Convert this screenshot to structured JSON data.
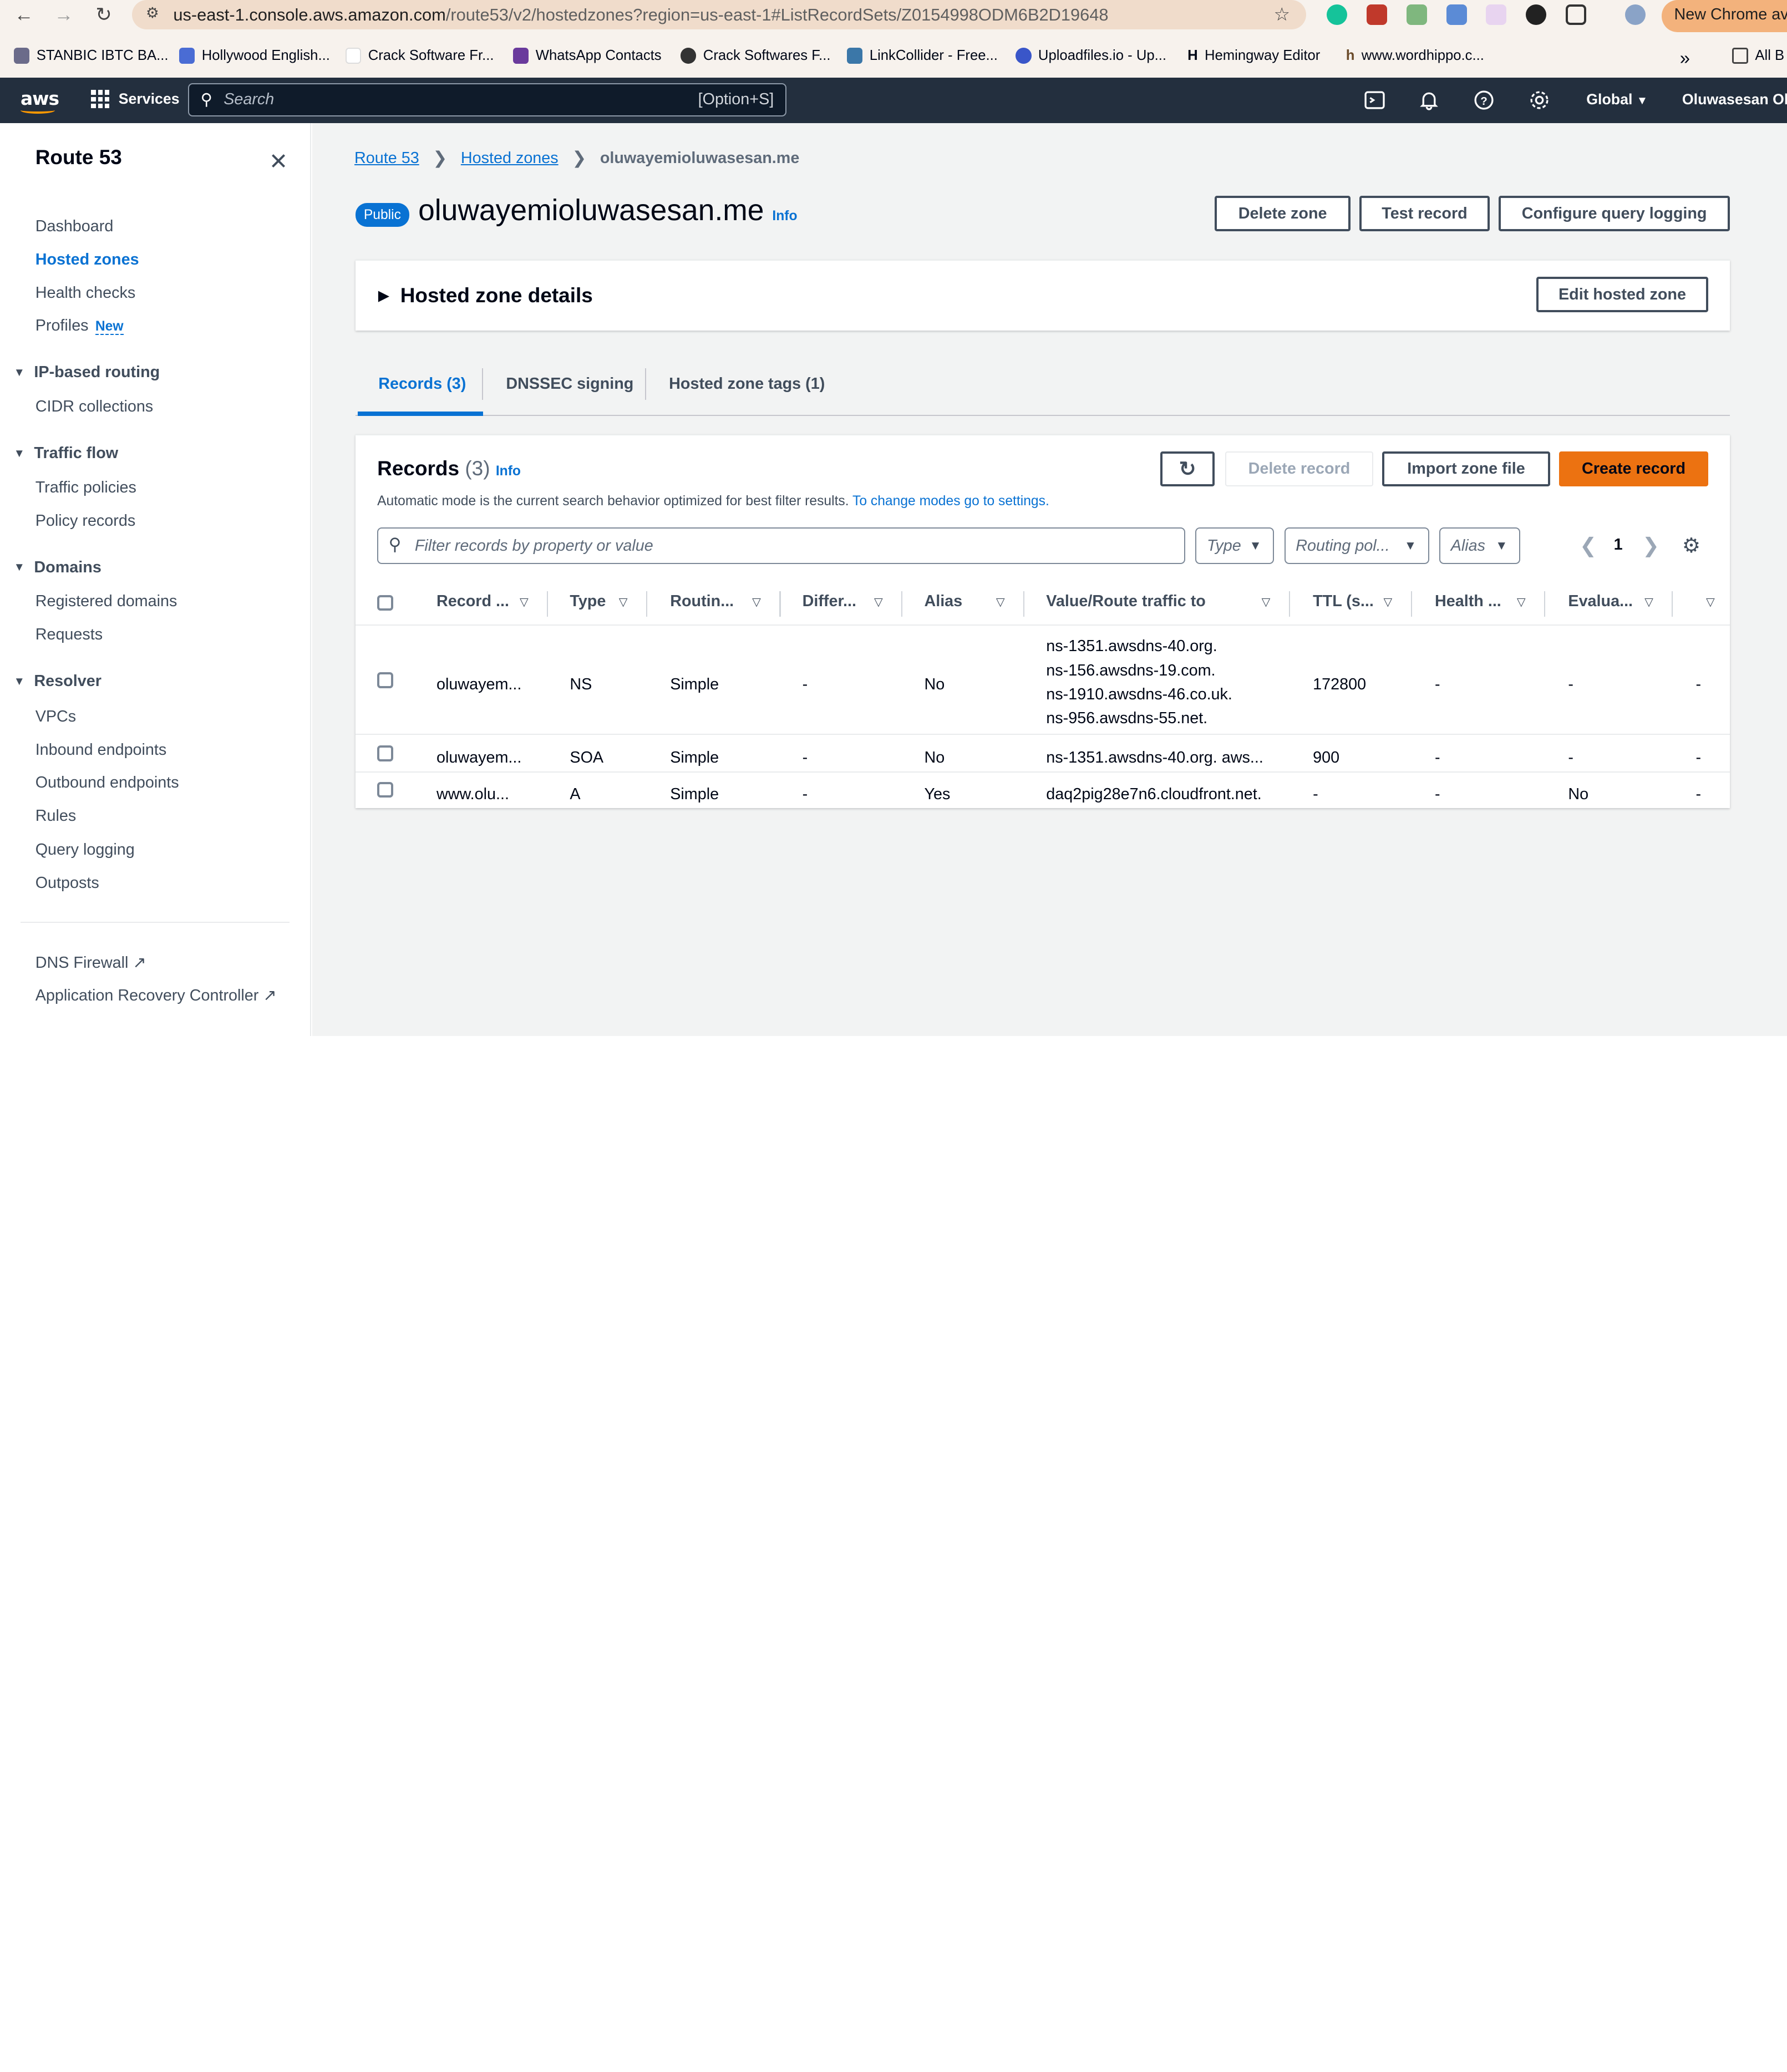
{
  "browser": {
    "url_host": "us-east-1.console.aws.amazon.com",
    "url_path": "/route53/v2/hostedzones?region=us-east-1#ListRecordSets/Z0154998ODM6B2D19648",
    "new_chrome_label": "New Chrome ava",
    "bookmarks": [
      "STANBIC IBTC BA...",
      "Hollywood English...",
      "Crack Software Fr...",
      "WhatsApp Contacts",
      "Crack Softwares F...",
      "LinkCollider - Free...",
      "Uploadfiles.io - Up...",
      "Hemingway Editor",
      "www.wordhippo.c..."
    ],
    "bookmarks_overflow": "»",
    "all_bookmarks": "All B"
  },
  "aws": {
    "logo": "aws",
    "services": "Services",
    "search_placeholder": "Search",
    "search_shortcut": "[Option+S]",
    "region": "Global",
    "user": "Oluwasesan Oluw"
  },
  "sidebar": {
    "title": "Route 53",
    "items": {
      "dashboard": "Dashboard",
      "hosted_zones": "Hosted zones",
      "health_checks": "Health checks",
      "profiles": "Profiles",
      "profiles_badge": "New",
      "ip_routing": "IP-based routing",
      "cidr": "CIDR collections",
      "traffic_flow": "Traffic flow",
      "traffic_policies": "Traffic policies",
      "policy_records": "Policy records",
      "domains": "Domains",
      "registered_domains": "Registered domains",
      "requests": "Requests",
      "resolver": "Resolver",
      "vpcs": "VPCs",
      "inbound": "Inbound endpoints",
      "outbound": "Outbound endpoints",
      "rules": "Rules",
      "query_logging": "Query logging",
      "outposts": "Outposts",
      "dns_firewall": "DNS Firewall",
      "arc": "Application Recovery Controller"
    }
  },
  "breadcrumb": {
    "route53": "Route 53",
    "hosted_zones": "Hosted zones",
    "current": "oluwayemioluwasesan.me"
  },
  "zone": {
    "badge": "Public",
    "name": "oluwayemioluwasesan.me",
    "info": "Info",
    "delete_zone": "Delete zone",
    "test_record": "Test record",
    "configure_logging": "Configure query logging",
    "details_title": "Hosted zone details",
    "edit_zone": "Edit hosted zone"
  },
  "tabs": {
    "records": "Records (3)",
    "dnssec": "DNSSEC signing",
    "tags": "Hosted zone tags (1)"
  },
  "records": {
    "title": "Records",
    "count": "(3)",
    "info": "Info",
    "delete_record": "Delete record",
    "import_zone": "Import zone file",
    "create_record": "Create record",
    "desc": "Automatic mode is the current search behavior optimized for best filter results.",
    "desc_link": "To change modes go to settings.",
    "filter_placeholder": "Filter records by property or value",
    "dd_type": "Type",
    "dd_routing": "Routing pol...",
    "dd_alias": "Alias",
    "page": "1",
    "columns": [
      "Record ...",
      "Type",
      "Routin...",
      "Differ...",
      "Alias",
      "Value/Route traffic to",
      "TTL (s...",
      "Health ...",
      "Evalua..."
    ],
    "rows": [
      {
        "name": "oluwayem...",
        "type": "NS",
        "routing": "Simple",
        "differ": "-",
        "alias": "No",
        "value1": "ns-1351.awsdns-40.org.",
        "value2": "ns-156.awsdns-19.com.",
        "value3": "ns-1910.awsdns-46.co.uk.",
        "value4": "ns-956.awsdns-55.net.",
        "ttl": "172800",
        "health": "-",
        "eval": "-",
        "last": "-"
      },
      {
        "name": "oluwayem...",
        "type": "SOA",
        "routing": "Simple",
        "differ": "-",
        "alias": "No",
        "value1": "ns-1351.awsdns-40.org. aws...",
        "ttl": "900",
        "health": "-",
        "eval": "-",
        "last": "-"
      },
      {
        "name": "www.olu...",
        "type": "A",
        "routing": "Simple",
        "differ": "-",
        "alias": "Yes",
        "value1": "daq2pig28e7n6.cloudfront.net.",
        "ttl": "-",
        "health": "-",
        "eval": "No",
        "last": "-"
      }
    ]
  }
}
